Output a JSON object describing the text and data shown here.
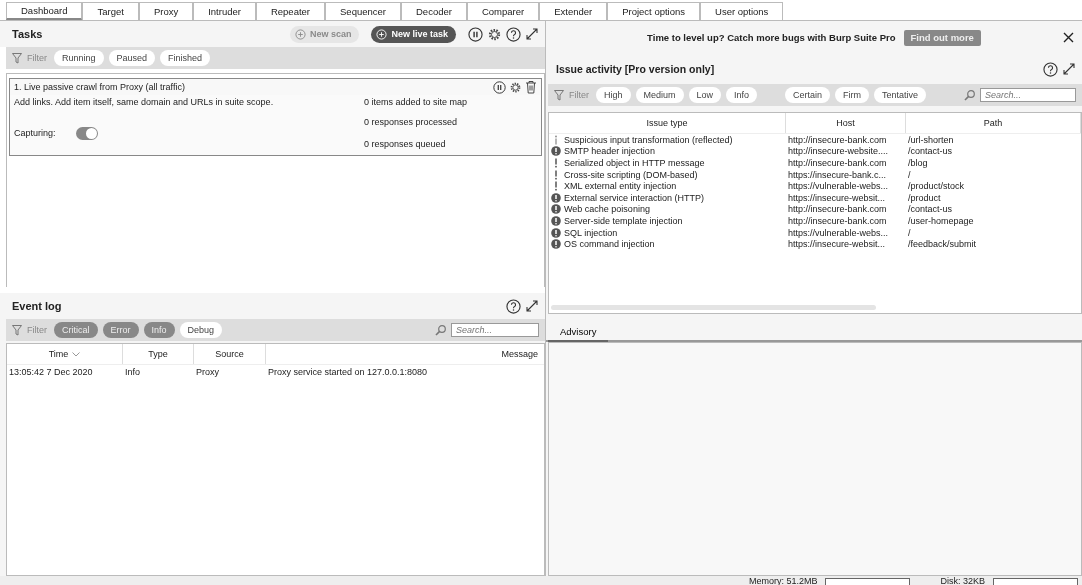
{
  "tabs": [
    {
      "label": "Dashboard",
      "selected": true
    },
    {
      "label": "Target",
      "selected": false
    },
    {
      "label": "Proxy",
      "selected": false
    },
    {
      "label": "Intruder",
      "selected": false
    },
    {
      "label": "Repeater",
      "selected": false
    },
    {
      "label": "Sequencer",
      "selected": false
    },
    {
      "label": "Decoder",
      "selected": false
    },
    {
      "label": "Comparer",
      "selected": false
    },
    {
      "label": "Extender",
      "selected": false
    },
    {
      "label": "Project options",
      "selected": false
    },
    {
      "label": "User options",
      "selected": false
    }
  ],
  "tasks": {
    "title": "Tasks",
    "buttons": [
      {
        "label": "New scan",
        "disabled": true
      },
      {
        "label": "New live task",
        "disabled": false
      }
    ],
    "filter": {
      "label": "Filter",
      "pills": [
        {
          "label": "Running",
          "selected": false
        },
        {
          "label": "Paused",
          "selected": false
        },
        {
          "label": "Finished",
          "selected": false
        }
      ]
    },
    "task": {
      "title": "1. Live passive crawl from Proxy (all traffic)",
      "description": "Add links. Add item itself, same domain and URLs in suite scope.",
      "capturing_label": "Capturing:",
      "capturing_on": true,
      "stats": [
        "0 items added to site map",
        "0 responses processed",
        "0 responses queued"
      ]
    }
  },
  "event_log": {
    "title": "Event log",
    "filter": {
      "label": "Filter",
      "pills": [
        {
          "label": "Critical",
          "selected": true
        },
        {
          "label": "Error",
          "selected": true
        },
        {
          "label": "Info",
          "selected": true
        },
        {
          "label": "Debug",
          "selected": false
        }
      ]
    },
    "search": {
      "placeholder": "Search..."
    },
    "columns": [
      "Time",
      "Type",
      "Source",
      "Message"
    ],
    "rows": [
      [
        "13:05:42 7 Dec 2020",
        "Info",
        "Proxy",
        "Proxy service started on 127.0.0.1:8080"
      ]
    ]
  },
  "banner": {
    "text": "Time to level up? Catch more bugs with Burp Suite Pro",
    "button": "Find out more"
  },
  "issue_activity": {
    "title": "Issue activity [Pro version only]",
    "filter": {
      "label": "Filter",
      "severity_pills": [
        {
          "label": "High",
          "selected": false
        },
        {
          "label": "Medium",
          "selected": false
        },
        {
          "label": "Low",
          "selected": false
        },
        {
          "label": "Info",
          "selected": false
        }
      ],
      "confidence_pills": [
        {
          "label": "Certain",
          "selected": false
        },
        {
          "label": "Firm",
          "selected": false
        },
        {
          "label": "Tentative",
          "selected": false
        }
      ]
    },
    "search": {
      "placeholder": "Search..."
    },
    "columns": [
      "Issue type",
      "Host",
      "Path"
    ],
    "rows": [
      {
        "kind": "info",
        "issue_type": "Suspicious input transformation (reflected)",
        "host": "http://insecure-bank.com",
        "path": "/url-shorten"
      },
      {
        "kind": "high",
        "issue_type": "SMTP header injection",
        "host": "http://insecure-website....",
        "path": "/contact-us"
      },
      {
        "kind": "low",
        "issue_type": "Serialized object in HTTP message",
        "host": "http://insecure-bank.com",
        "path": "/blog"
      },
      {
        "kind": "low",
        "issue_type": "Cross-site scripting (DOM-based)",
        "host": "https://insecure-bank.c...",
        "path": "/"
      },
      {
        "kind": "low",
        "issue_type": "XML external entity injection",
        "host": "https://vulnerable-webs...",
        "path": "/product/stock"
      },
      {
        "kind": "high",
        "issue_type": "External service interaction (HTTP)",
        "host": "https://insecure-websit...",
        "path": "/product"
      },
      {
        "kind": "high",
        "issue_type": "Web cache poisoning",
        "host": "http://insecure-bank.com",
        "path": "/contact-us"
      },
      {
        "kind": "high",
        "issue_type": "Server-side template injection",
        "host": "http://insecure-bank.com",
        "path": "/user-homepage"
      },
      {
        "kind": "high",
        "issue_type": "SQL injection",
        "host": "https://vulnerable-webs...",
        "path": "/"
      },
      {
        "kind": "high",
        "issue_type": "OS command injection",
        "host": "https://insecure-websit...",
        "path": "/feedback/submit"
      }
    ]
  },
  "advisory": {
    "tabs": [
      {
        "label": "Advisory",
        "selected": true
      }
    ]
  },
  "status_bar": {
    "memory": "Memory: 51.2MB",
    "disk": "Disk: 32KB"
  }
}
